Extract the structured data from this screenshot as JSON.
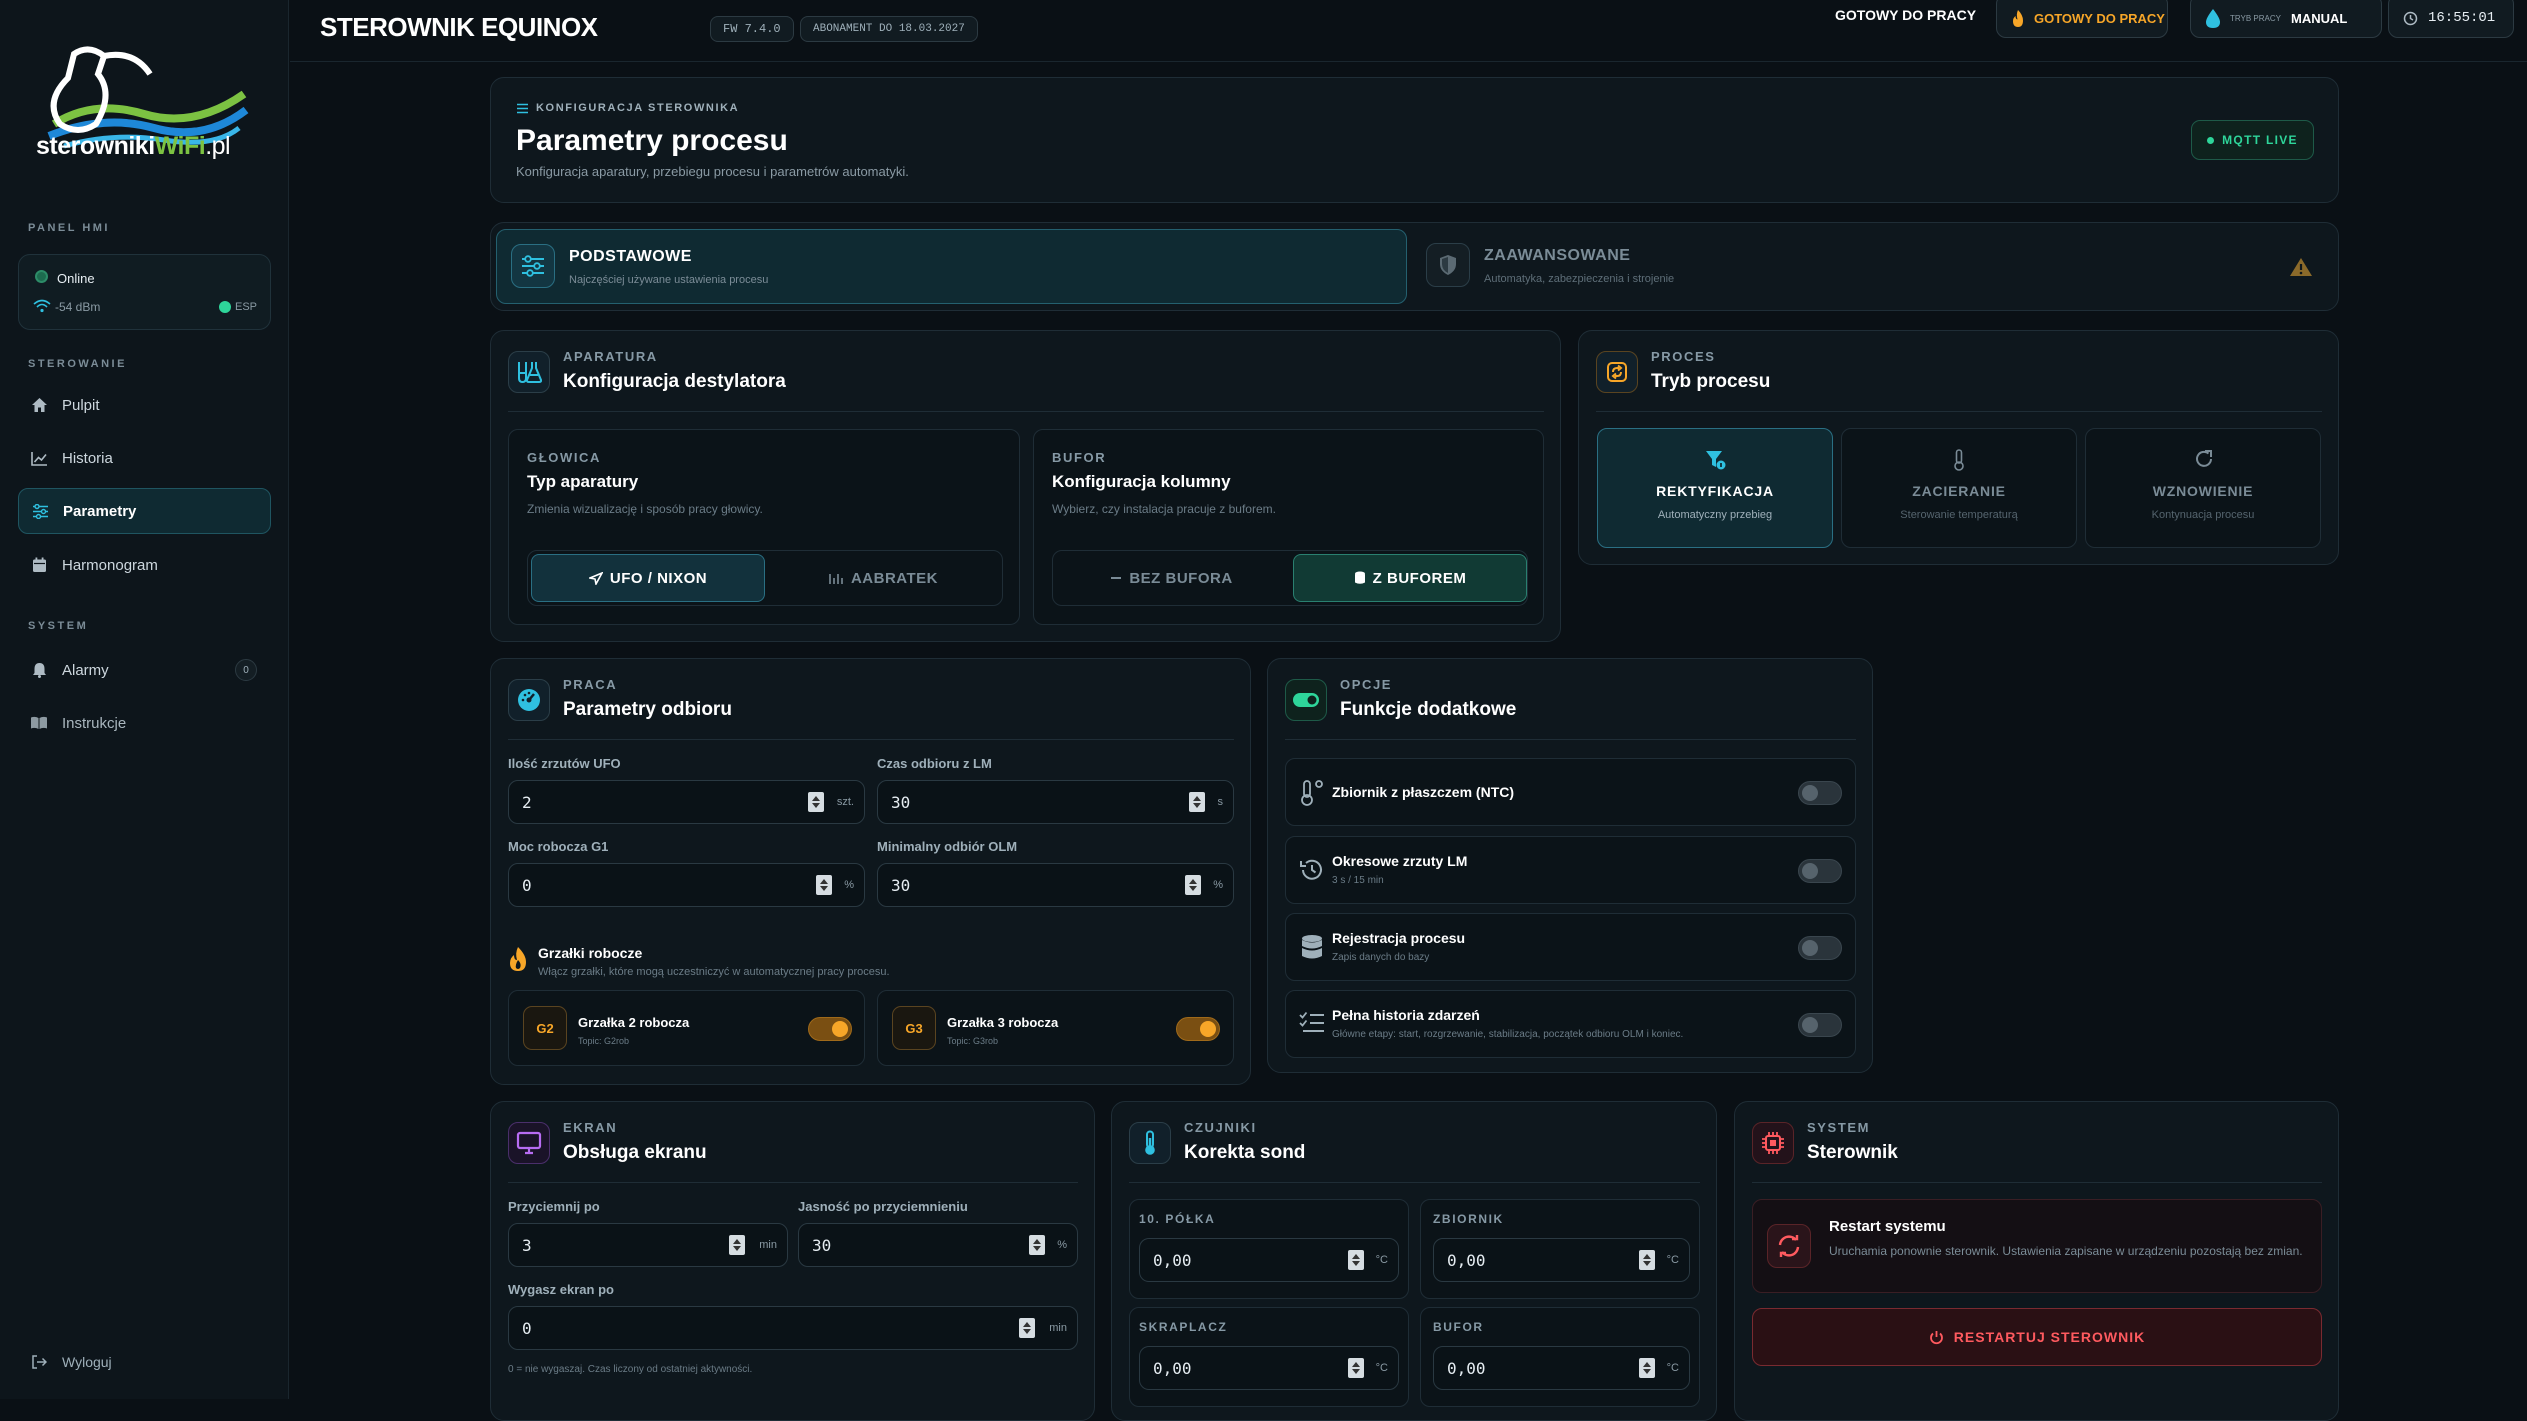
{
  "app": {
    "title": "STEROWNIK EQUINOX",
    "fw": "FW 7.4.0",
    "subscription": "ABONAMENT DO 18.03.2027"
  },
  "topbar": {
    "ready_label": "GOTOWY DO PRACY",
    "ready_badge": "GOTOWY DO PRACY",
    "mode_caption": "TRYB PRACY",
    "mode_value": "MANUAL",
    "clock": "16:55:01"
  },
  "logo": {
    "part1": "sterowniki",
    "part2": "WiFi",
    "part3": ".pl"
  },
  "sidebar": {
    "panel_label": "PANEL HMI",
    "status": {
      "online": "Online",
      "signal": "-54 dBm",
      "esp": "ESP"
    },
    "steering_label": "STEROWANIE",
    "items": [
      {
        "label": "Pulpit",
        "icon": "home-icon"
      },
      {
        "label": "Historia",
        "icon": "chart-line-icon"
      },
      {
        "label": "Parametry",
        "icon": "sliders-icon"
      },
      {
        "label": "Harmonogram",
        "icon": "calendar-icon"
      }
    ],
    "system_label": "SYSTEM",
    "system_items": [
      {
        "label": "Alarmy",
        "icon": "bell-icon",
        "badge": "0"
      },
      {
        "label": "Instrukcje",
        "icon": "book-icon"
      }
    ],
    "logout": "Wyloguj"
  },
  "header": {
    "overline": "KONFIGURACJA STEROWNIKA",
    "title": "Parametry procesu",
    "subtitle": "Konfiguracja aparatury, przebiegu procesu i parametrów automatyki.",
    "mqtt": "MQTT LIVE"
  },
  "tabs": [
    {
      "title": "PODSTAWOWE",
      "desc": "Najczęściej używane ustawienia procesu"
    },
    {
      "title": "ZAAWANSOWANE",
      "desc": "Automatyka, zabezpieczenia i strojenie"
    }
  ],
  "apparatus": {
    "overline": "APARATURA",
    "title": "Konfiguracja destylatora",
    "head": {
      "overline": "GŁOWICA",
      "title": "Typ aparatury",
      "desc": "Zmienia wizualizację i sposób pracy głowicy.",
      "opt1": "UFO / NIXON",
      "opt2": "AABRATEK"
    },
    "buffer": {
      "overline": "BUFOR",
      "title": "Konfiguracja kolumny",
      "desc": "Wybierz, czy instalacja pracuje z buforem.",
      "opt1": "BEZ BUFORA",
      "opt2": "Z BUFOREM"
    }
  },
  "process": {
    "overline": "PROCES",
    "title": "Tryb procesu",
    "modes": [
      {
        "title": "REKTYFIKACJA",
        "desc": "Automatyczny przebieg"
      },
      {
        "title": "ZACIERANIE",
        "desc": "Sterowanie temperaturą"
      },
      {
        "title": "WZNOWIENIE",
        "desc": "Kontynuacja procesu"
      }
    ]
  },
  "work": {
    "overline": "PRACA",
    "title": "Parametry odbioru",
    "fields": [
      {
        "label": "Ilość zrzutów UFO",
        "value": "2",
        "unit": "szt."
      },
      {
        "label": "Czas odbioru z LM",
        "value": "30",
        "unit": "s"
      },
      {
        "label": "Moc robocza G1",
        "value": "0",
        "unit": "%"
      },
      {
        "label": "Minimalny odbiór OLM",
        "value": "30",
        "unit": "%"
      }
    ],
    "heaters_title": "Grzałki robocze",
    "heaters_desc": "Włącz grzałki, które mogą uczestniczyć w automatycznej pracy procesu.",
    "heaters": [
      {
        "code": "G2",
        "name": "Grzałka 2 robocza",
        "topic": "Topic: G2rob"
      },
      {
        "code": "G3",
        "name": "Grzałka 3 robocza",
        "topic": "Topic: G3rob"
      }
    ]
  },
  "options": {
    "overline": "OPCJE",
    "title": "Funkcje dodatkowe",
    "items": [
      {
        "label": "Zbiornik z płaszczem (NTC)",
        "desc": ""
      },
      {
        "label": "Okresowe zrzuty LM",
        "desc": "3 s / 15 min"
      },
      {
        "label": "Rejestracja procesu",
        "desc": "Zapis danych do bazy"
      },
      {
        "label": "Pełna historia zdarzeń",
        "desc": "Główne etapy: start, rozgrzewanie, stabilizacja, początek odbioru OLM i koniec."
      }
    ]
  },
  "screen": {
    "overline": "EKRAN",
    "title": "Obsługa ekranu",
    "fields": [
      {
        "label": "Przyciemnij po",
        "value": "3",
        "unit": "min"
      },
      {
        "label": "Jasność po przyciemnieniu",
        "value": "30",
        "unit": "%"
      },
      {
        "label": "Wygasz ekran po",
        "value": "0",
        "unit": "min"
      }
    ],
    "hint": "0 = nie wygaszaj. Czas liczony od ostatniej aktywności."
  },
  "sensors": {
    "overline": "CZUJNIKI",
    "title": "Korekta sond",
    "items": [
      {
        "label": "10. PÓŁKA",
        "value": "0,00",
        "unit": "°C"
      },
      {
        "label": "ZBIORNIK",
        "value": "0,00",
        "unit": "°C"
      },
      {
        "label": "SKRAPLACZ",
        "value": "0,00",
        "unit": "°C"
      },
      {
        "label": "BUFOR",
        "value": "0,00",
        "unit": "°C"
      }
    ]
  },
  "system": {
    "overline": "SYSTEM",
    "title": "Sterownik",
    "restart_title": "Restart systemu",
    "restart_desc": "Uruchamia ponownie sterownik. Ustawienia zapisane w urządzeniu pozostają bez zmian.",
    "restart_button": "RESTARTUJ STEROWNIK"
  },
  "colors": {
    "accent": "#2fc0e0",
    "orange": "#f7a628",
    "green": "#2ed59a",
    "danger": "#ff5a5f"
  }
}
